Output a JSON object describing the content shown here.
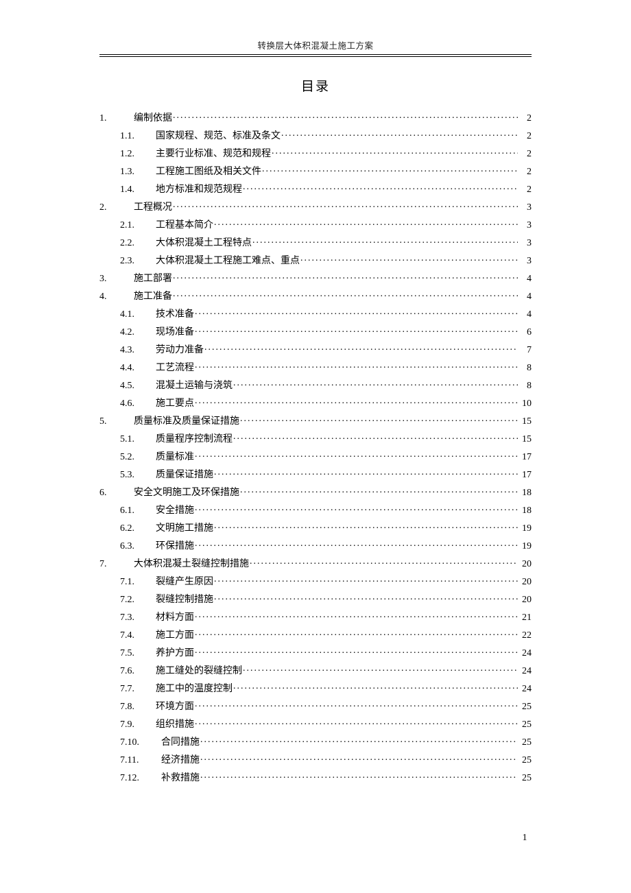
{
  "header_title": "转换层大体积混凝土施工方案",
  "toc_title": "目录",
  "page_number": "1",
  "toc": [
    {
      "level": 1,
      "num": "1.",
      "text": "编制依据",
      "page": "2"
    },
    {
      "level": 2,
      "num": "1.1.",
      "text": "国家规程、规范、标准及条文",
      "page": "2"
    },
    {
      "level": 2,
      "num": "1.2.",
      "text": "主要行业标准、规范和规程",
      "page": "2"
    },
    {
      "level": 2,
      "num": "1.3.",
      "text": "工程施工图纸及相关文件",
      "page": "2"
    },
    {
      "level": 2,
      "num": "1.4.",
      "text": "地方标准和规范规程",
      "page": "2"
    },
    {
      "level": 1,
      "num": "2.",
      "text": "工程概况",
      "page": "3"
    },
    {
      "level": 2,
      "num": "2.1.",
      "text": "工程基本简介",
      "page": "3"
    },
    {
      "level": 2,
      "num": "2.2.",
      "text": "大体积混凝土工程特点",
      "page": "3"
    },
    {
      "level": 2,
      "num": "2.3.",
      "text": "大体积混凝土工程施工难点、重点",
      "page": "3"
    },
    {
      "level": 1,
      "num": "3.",
      "text": "施工部署",
      "page": "4"
    },
    {
      "level": 1,
      "num": "4.",
      "text": "施工准备",
      "page": "4"
    },
    {
      "level": 2,
      "num": "4.1.",
      "text": "技术准备",
      "page": "4"
    },
    {
      "level": 2,
      "num": "4.2.",
      "text": "现场准备",
      "page": "6"
    },
    {
      "level": 2,
      "num": "4.3.",
      "text": "劳动力准备",
      "page": "7"
    },
    {
      "level": 2,
      "num": "4.4.",
      "text": "工艺流程",
      "page": "8"
    },
    {
      "level": 2,
      "num": "4.5.",
      "text": "混凝土运输与浇筑",
      "page": "8"
    },
    {
      "level": 2,
      "num": "4.6.",
      "text": "施工要点",
      "page": "10"
    },
    {
      "level": 1,
      "num": "5.",
      "text": "质量标准及质量保证措施",
      "page": "15"
    },
    {
      "level": 2,
      "num": "5.1.",
      "text": "质量程序控制流程",
      "page": "15"
    },
    {
      "level": 2,
      "num": "5.2.",
      "text": "质量标准",
      "page": "17"
    },
    {
      "level": 2,
      "num": "5.3.",
      "text": "质量保证措施",
      "page": "17"
    },
    {
      "level": 1,
      "num": "6.",
      "text": "安全文明施工及环保措施",
      "page": "18"
    },
    {
      "level": 2,
      "num": "6.1.",
      "text": "安全措施",
      "page": "18"
    },
    {
      "level": 2,
      "num": "6.2.",
      "text": "文明施工措施",
      "page": "19"
    },
    {
      "level": 2,
      "num": "6.3.",
      "text": "环保措施",
      "page": "19"
    },
    {
      "level": 1,
      "num": "7.",
      "text": "大体积混凝土裂缝控制措施",
      "page": "20"
    },
    {
      "level": 2,
      "num": "7.1.",
      "text": "裂缝产生原因",
      "page": "20"
    },
    {
      "level": 2,
      "num": "7.2.",
      "text": "裂缝控制措施",
      "page": "20"
    },
    {
      "level": 2,
      "num": "7.3.",
      "text": "材料方面",
      "page": "21"
    },
    {
      "level": 2,
      "num": "7.4.",
      "text": "施工方面",
      "page": "22"
    },
    {
      "level": 2,
      "num": "7.5.",
      "text": "养护方面",
      "page": "24"
    },
    {
      "level": 2,
      "num": "7.6.",
      "text": "施工缝处的裂缝控制",
      "page": "24"
    },
    {
      "level": 2,
      "num": "7.7.",
      "text": "施工中的温度控制",
      "page": "24"
    },
    {
      "level": 2,
      "num": "7.8.",
      "text": "环境方面",
      "page": "25"
    },
    {
      "level": 2,
      "num": "7.9.",
      "text": "组织措施",
      "page": "25"
    },
    {
      "level": 2,
      "num": "7.10.",
      "text": "合同措施",
      "page": "25",
      "wide": true
    },
    {
      "level": 2,
      "num": "7.11.",
      "text": "经济措施",
      "page": "25",
      "wide": true
    },
    {
      "level": 2,
      "num": "7.12.",
      "text": "补救措施",
      "page": "25",
      "wide": true
    }
  ]
}
